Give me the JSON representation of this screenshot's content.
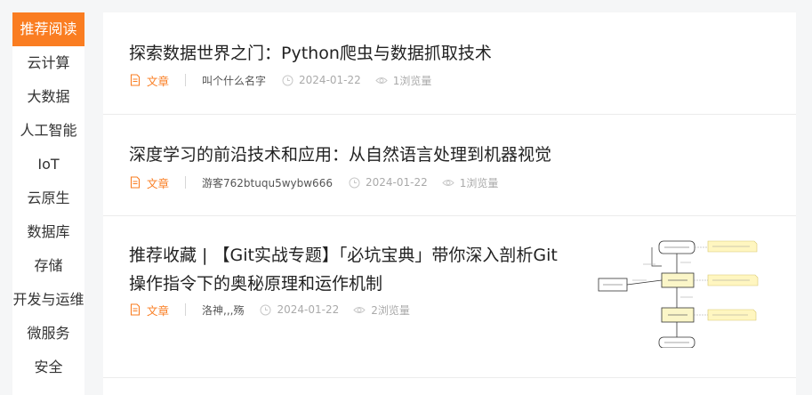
{
  "sidebar": {
    "items": [
      {
        "label": "推荐阅读",
        "active": true
      },
      {
        "label": "云计算"
      },
      {
        "label": "大数据"
      },
      {
        "label": "人工智能"
      },
      {
        "label": "IoT"
      },
      {
        "label": "云原生"
      },
      {
        "label": "数据库"
      },
      {
        "label": "存储"
      },
      {
        "label": "开发与运维"
      },
      {
        "label": "微服务"
      },
      {
        "label": "安全"
      }
    ]
  },
  "articles": [
    {
      "title": "探索数据世界之门：Python爬虫与数据抓取技术",
      "type": "文章",
      "author": "叫个什么名字",
      "date": "2024-01-22",
      "views": "1浏览量"
    },
    {
      "title": "深度学习的前沿技术和应用：从自然语言处理到机器视觉",
      "type": "文章",
      "author": "游客762btuqu5wybw666",
      "date": "2024-01-22",
      "views": "1浏览量"
    },
    {
      "title": "推荐收藏 | 【Git实战专题】「必坑宝典」带你深入剖析Git操作指令下的奥秘原理和运作机制",
      "type": "文章",
      "author": "洛神,,,殇",
      "date": "2024-01-22",
      "views": "2浏览量",
      "thumbnail": "git-workflow-diagram"
    }
  ],
  "colors": {
    "accent": "#fa7d21",
    "text": "#222222",
    "muted": "#aaaaaa"
  }
}
